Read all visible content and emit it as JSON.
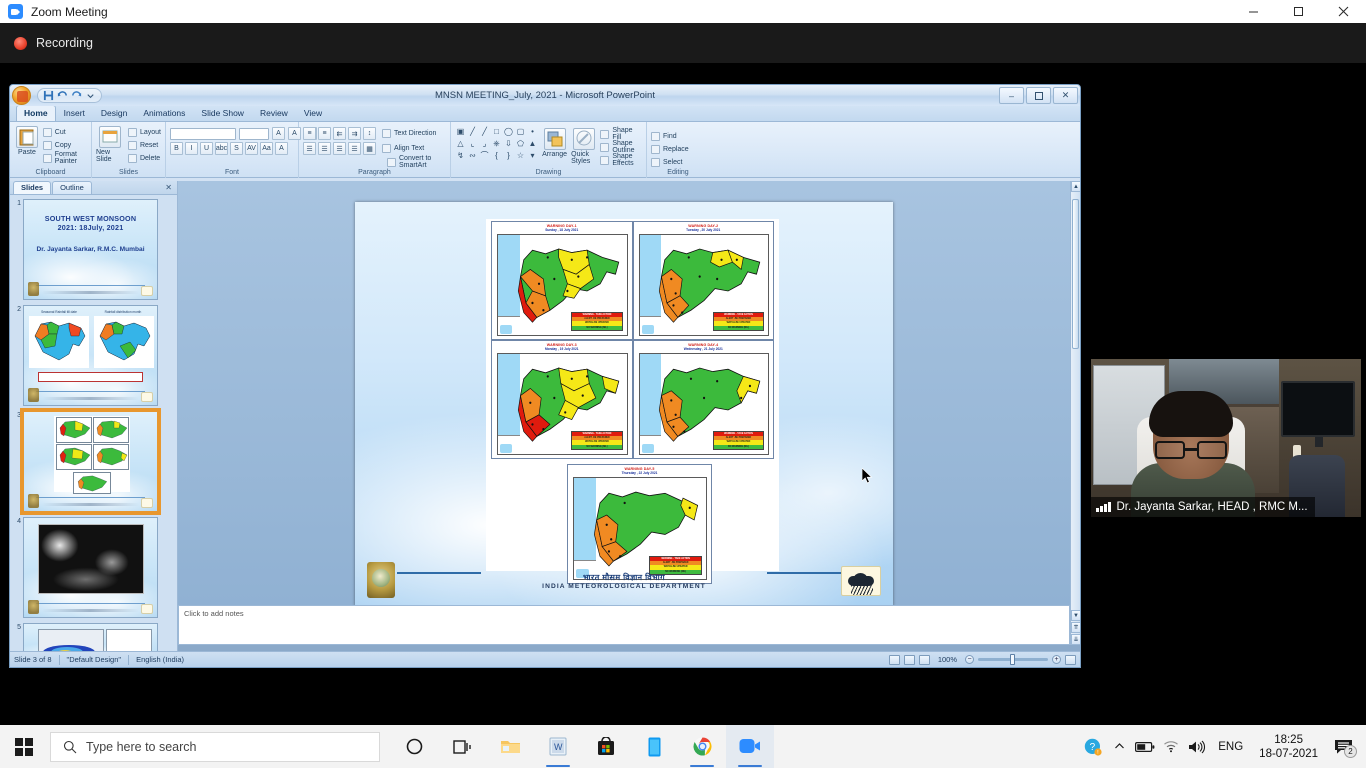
{
  "zoom_window": {
    "title": "Zoom Meeting",
    "recording_label": "Recording",
    "minimize": "–",
    "maximize": "❐",
    "close": "✕"
  },
  "powerpoint": {
    "title": "MNSN MEETING_July, 2021 - Microsoft PowerPoint",
    "quick_access": [
      "save-icon",
      "undo-icon",
      "redo-icon",
      "customize-qat-icon"
    ],
    "window_controls": {
      "minimize": "–",
      "restore": "❐",
      "close": "✕"
    },
    "ribbon_tabs": [
      {
        "label": "Home",
        "active": true
      },
      {
        "label": "Insert",
        "active": false
      },
      {
        "label": "Design",
        "active": false
      },
      {
        "label": "Animations",
        "active": false
      },
      {
        "label": "Slide Show",
        "active": false
      },
      {
        "label": "Review",
        "active": false
      },
      {
        "label": "View",
        "active": false
      }
    ],
    "groups": {
      "clipboard": {
        "title": "Clipboard",
        "paste": "Paste",
        "cut": "Cut",
        "copy": "Copy",
        "format_painter": "Format Painter"
      },
      "slides": {
        "title": "Slides",
        "new_slide": "New Slide",
        "layout": "Layout",
        "reset": "Reset",
        "delete": "Delete"
      },
      "font": {
        "title": "Font",
        "font_name": "",
        "font_size": "",
        "grow": "A",
        "shrink": "A",
        "clear": "Clear Formatting",
        "bold": "B",
        "italic": "I",
        "underline": "U",
        "strike": "abc",
        "shadow": "S",
        "spacing": "AV",
        "case": "Aa",
        "color": "A"
      },
      "paragraph": {
        "title": "Paragraph",
        "text_direction": "Text Direction",
        "align_text": "Align Text",
        "convert_smartart": "Convert to SmartArt"
      },
      "drawing": {
        "title": "Drawing",
        "arrange": "Arrange",
        "quick_styles": "Quick Styles",
        "shape_fill": "Shape Fill",
        "shape_outline": "Shape Outline",
        "shape_effects": "Shape Effects"
      },
      "editing": {
        "title": "Editing",
        "find": "Find",
        "replace": "Replace",
        "select": "Select"
      }
    },
    "slides_pane": {
      "tab_slides": "Slides",
      "tab_outline": "Outline",
      "close": "✕",
      "thumbnails": [
        {
          "number": "1",
          "kind": "title",
          "title_line1": "SOUTH WEST MONSOON",
          "title_line2": "2021: 18July, 2021",
          "subtitle": "Dr. Jayanta  Sarkar, R.M.C. Mumbai"
        },
        {
          "number": "2",
          "kind": "two-maps",
          "cap_left": "Seasonal Rainfall till date",
          "cap_right": "Rainfall distribution month"
        },
        {
          "number": "3",
          "kind": "five-maps",
          "selected": true
        },
        {
          "number": "4",
          "kind": "satellite"
        },
        {
          "number": "5",
          "kind": "chart"
        }
      ]
    },
    "slide": {
      "footer_hindi": "भारत मौसम विज्ञान विभाग",
      "footer_english": "INDIA METEOROLOGICAL DEPARTMENT",
      "maps": [
        {
          "title": "WARNING DAY-1",
          "date": "Sunday , 18 July 2021"
        },
        {
          "title": "WARNING DAY-2",
          "date": "Tuesday , 20 July 2021"
        },
        {
          "title": "WARNING DAY-3",
          "date": "Monday , 19 July 2021"
        },
        {
          "title": "WARNING DAY-4",
          "date": "Wednesday , 21 July 2021"
        },
        {
          "title": "WARNING DAY-5",
          "date": "Thursday , 22 July 2021"
        }
      ],
      "legend": [
        {
          "label": "WARNING - TAKE ACTION",
          "color": "#e01b0e"
        },
        {
          "label": "ALERT -BE PREPARED",
          "color": "#f08a22"
        },
        {
          "label": "WATCH-BE UPDATED",
          "color": "#f5e817"
        },
        {
          "label": "NO WARNING (NIL)",
          "color": "#3fbb3f"
        }
      ]
    },
    "notes_placeholder": "Click to add notes",
    "status": {
      "slide_counter": "Slide 3 of 8",
      "design": "\"Default Design\"",
      "language": "English (India)",
      "zoom_level": "100%",
      "views": [
        "normal-view-icon",
        "slide-sorter-icon",
        "slide-show-icon"
      ],
      "zoom_out": "−",
      "zoom_in": "+",
      "fit_slide": "fit-to-window-icon"
    }
  },
  "participant": {
    "name": "Dr. Jayanta Sarkar, HEAD , RMC M...",
    "signal_icon": "signal-bars-icon"
  },
  "taskbar": {
    "start": "start-icon",
    "search_placeholder": "Type here to search",
    "search_icon": "search-icon",
    "items": [
      {
        "name": "cortana-icon",
        "label": "Cortana"
      },
      {
        "name": "task-view-icon",
        "label": "Task View"
      },
      {
        "name": "file-explorer-icon",
        "label": "File Explorer"
      },
      {
        "name": "word-icon",
        "label": "Microsoft Word"
      },
      {
        "name": "microsoft-store-icon",
        "label": "Microsoft Store"
      },
      {
        "name": "your-phone-icon",
        "label": "Your Phone"
      },
      {
        "name": "chrome-icon",
        "label": "Google Chrome"
      },
      {
        "name": "zoom-icon",
        "label": "Zoom"
      }
    ],
    "tray": {
      "help_icon": "help-question-icon",
      "chevron": "⌃",
      "battery_icon": "battery-icon",
      "wifi_icon": "wifi-icon",
      "volume_icon": "volume-icon",
      "language": "ENG",
      "time": "18:25",
      "date": "18-07-2021",
      "notification_count": "2"
    }
  },
  "colors": {
    "accent": "#2d8cff",
    "warning_red": "#e01b0e",
    "warning_orange": "#f08a22",
    "warning_yellow": "#f5e817",
    "warning_green": "#3fbb3f"
  }
}
